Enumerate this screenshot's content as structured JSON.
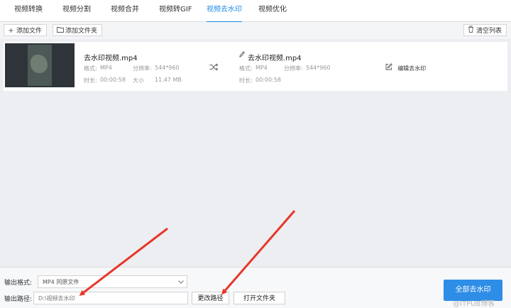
{
  "tabs": [
    {
      "label": "视频转换"
    },
    {
      "label": "视频分割"
    },
    {
      "label": "视频合并"
    },
    {
      "label": "视频转GIF"
    },
    {
      "label": "视频去水印"
    },
    {
      "label": "视频优化"
    }
  ],
  "toolbar": {
    "add_file": "添加文件",
    "add_folder": "添加文件夹",
    "clear_list": "清空列表"
  },
  "file": {
    "source": {
      "name": "去水印视频.mp4",
      "format_label": "格式:",
      "format": "MP4",
      "resolution_label": "分辨率:",
      "resolution": "544*960",
      "duration_label": "时长:",
      "duration": "00:00:58",
      "size_label": "大小",
      "size": "11.47 MB"
    },
    "output": {
      "name": "去水印视频.mp4",
      "format_label": "格式:",
      "format": "MP4",
      "resolution_label": "分辨率:",
      "resolution": "544*960",
      "duration_label": "时长:",
      "duration": "00:00:58"
    },
    "edit_label": "编辑去水印"
  },
  "footer": {
    "format_label": "输出格式:",
    "format_value": "MP4  同原文件",
    "path_label": "输出路径:",
    "path_value": "D:\\视频去水印",
    "change_path": "更改路径",
    "open_folder": "打开文件夹",
    "remove_all": "全部去水印"
  },
  "watermark": "@ITPUB博客",
  "colors": {
    "accent": "#1e8ae8",
    "primary_button": "#2e8de6",
    "annotation_arrow": "#e8362a"
  }
}
